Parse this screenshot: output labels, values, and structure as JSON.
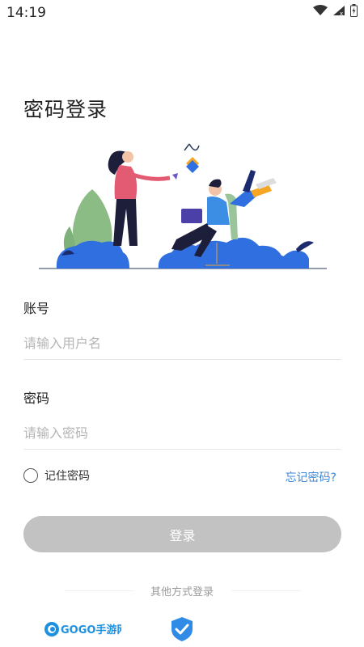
{
  "status_bar": {
    "time": "14:19"
  },
  "page": {
    "title": "密码登录"
  },
  "form": {
    "account_label": "账号",
    "account_placeholder": "请输入用户名",
    "password_label": "密码",
    "password_placeholder": "请输入密码",
    "remember_label": "记住密码",
    "forgot_label": "忘记密码?",
    "login_label": "登录"
  },
  "other_login": {
    "label": "其他方式登录",
    "options": [
      {
        "name": "GOGO手游网",
        "icon": "gogo-logo"
      },
      {
        "name": "verified",
        "icon": "shield-check-icon"
      }
    ]
  },
  "colors": {
    "accent": "#3a86d8",
    "button_disabled": "#c2c2c2",
    "illustration_blue": "#2f6fe0"
  }
}
